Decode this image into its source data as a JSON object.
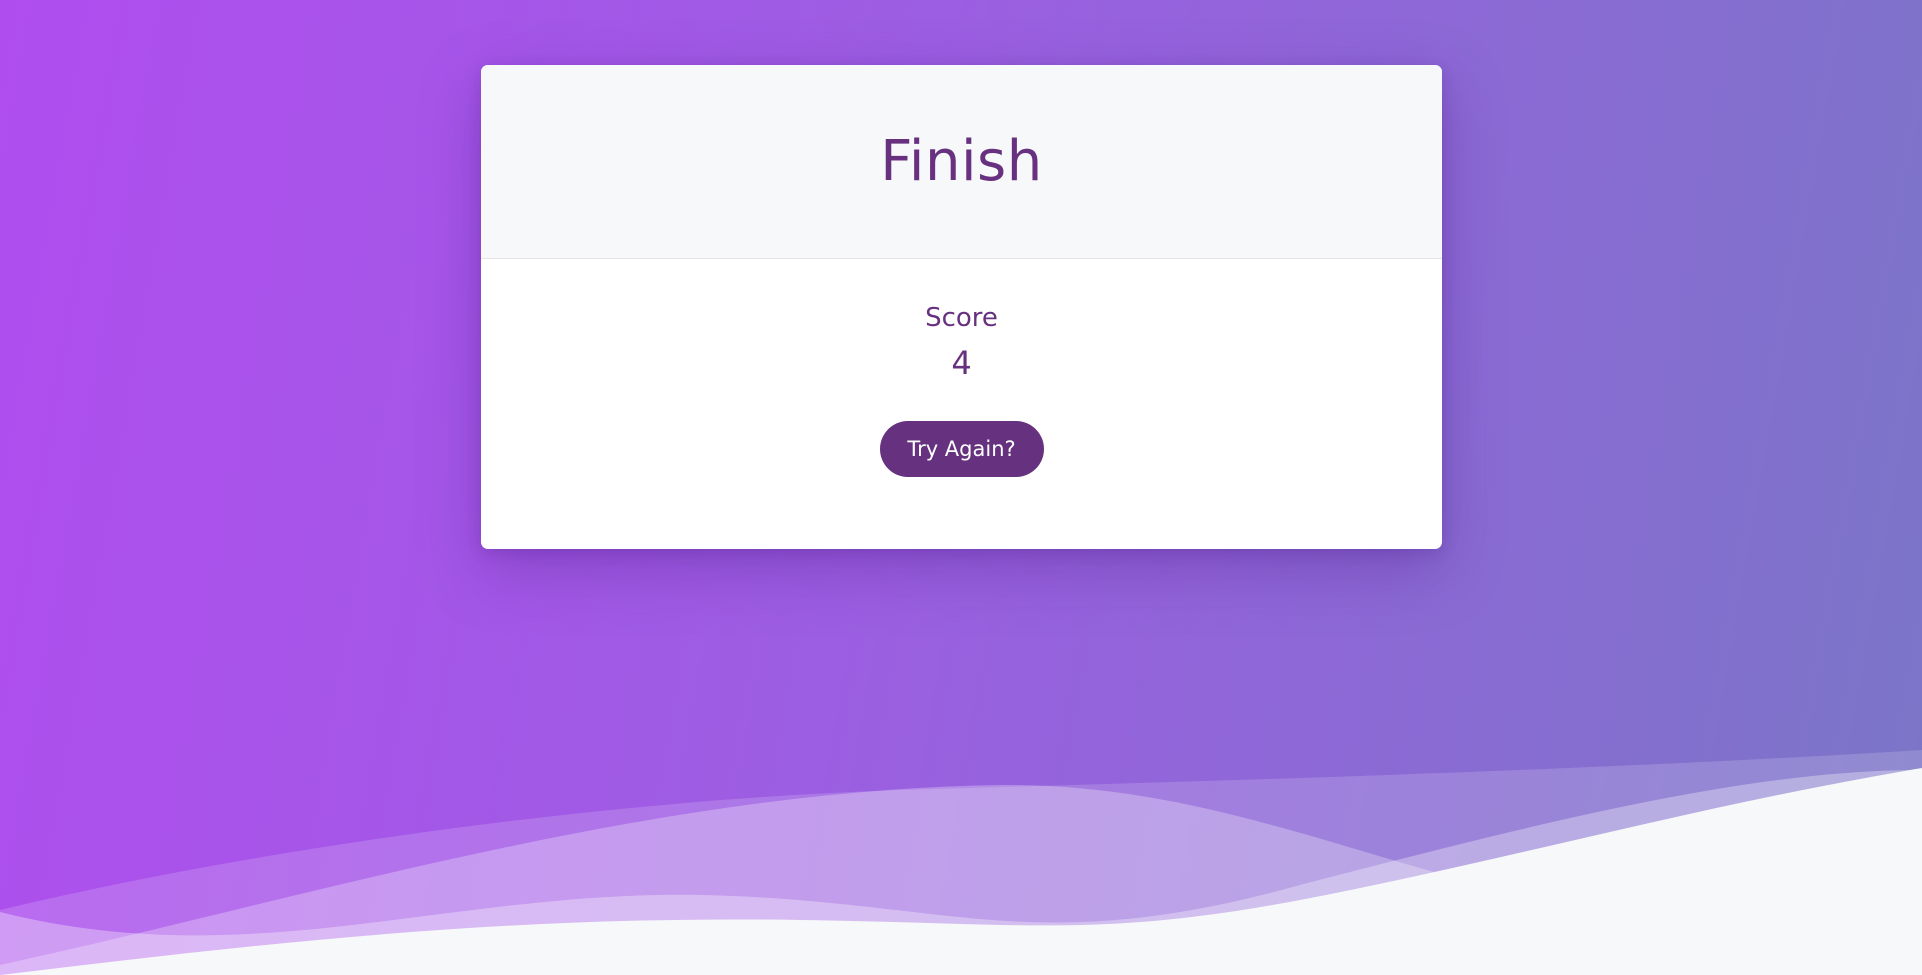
{
  "card": {
    "title": "Finish",
    "score_label": "Score",
    "score_value": "4",
    "try_again_label": "Try Again?"
  },
  "colors": {
    "background_start": "#b04def",
    "background_end": "#7a76c7",
    "accent": "#66317f",
    "card_header": "#f7f8f9",
    "card_body": "#ffffff",
    "footer": "#f7f8f9"
  }
}
